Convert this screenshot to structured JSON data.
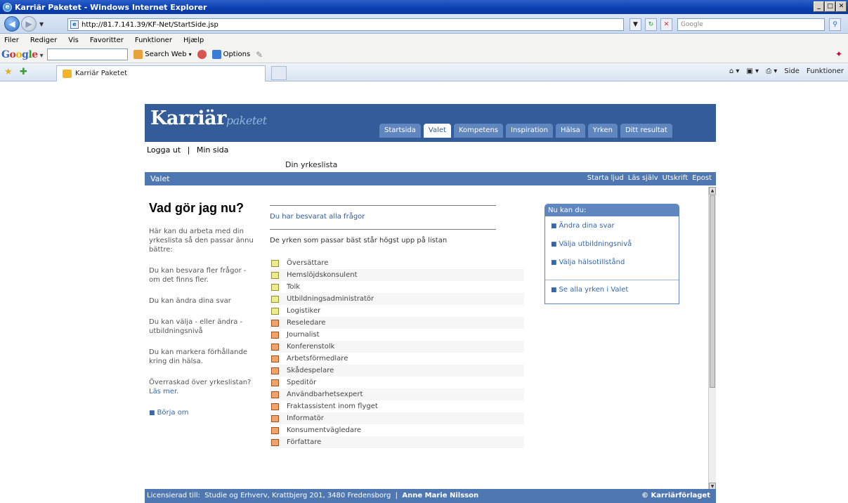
{
  "window": {
    "title": "Karriär Paketet - Windows Internet Explorer",
    "min": "_",
    "max": "□",
    "close": "✕"
  },
  "address": {
    "url": "http://81.7.141.39/KF-Net/StartSide.jsp",
    "search_placeholder": "Google"
  },
  "menu": [
    "Filer",
    "Rediger",
    "Vis",
    "Favoritter",
    "Funktioner",
    "Hjælp"
  ],
  "google_toolbar": {
    "logo": "Google",
    "search_web": "Search Web",
    "options": "Options"
  },
  "tab": {
    "title": "Karriär Paketet"
  },
  "command_bar": [
    "Side",
    "Funktioner"
  ],
  "site": {
    "logo_main": "Karriär",
    "logo_sub": "paketet",
    "nav": [
      "Startsida",
      "Valet",
      "Kompetens",
      "Inspiration",
      "Hälsa",
      "Yrken",
      "Ditt resultat"
    ],
    "active_nav": "Valet",
    "login": "Logga ut",
    "separator": "|",
    "min_sida": "Min sida",
    "subtitle": "Din yrkeslista",
    "section": "Valet",
    "tools": [
      "Starta ljud",
      "Läs själv",
      "Utskrift",
      "Epost"
    ]
  },
  "left": {
    "heading": "Vad gör jag nu?",
    "paras": [
      "Här kan du arbeta med din yrkeslista så den passar ännu bättre:",
      "Du kan besvara fler frågor - om det finns fler.",
      "Du kan ändra dina svar",
      "Du kan välja - eller ändra - utbildningsnivå",
      "Du kan markera förhållande kring din hälsa."
    ],
    "overraskad": "Överraskad över yrkeslistan?",
    "las_mer": "Läs mer.",
    "borja_om": "Börja om"
  },
  "middle": {
    "answered": "Du har besvarat alla frågor",
    "intro": "De yrken som passar bäst står högst upp på listan",
    "jobs": [
      {
        "name": "Översättare",
        "color": "yellow"
      },
      {
        "name": "Hemslöjdskonsulent",
        "color": "yellow"
      },
      {
        "name": "Tolk",
        "color": "yellow"
      },
      {
        "name": "Utbildningsadministratör",
        "color": "yellow"
      },
      {
        "name": "Logistiker",
        "color": "yellow"
      },
      {
        "name": "Reseledare",
        "color": "orange"
      },
      {
        "name": "Journalist",
        "color": "orange"
      },
      {
        "name": "Konferenstolk",
        "color": "orange"
      },
      {
        "name": "Arbetsförmedlare",
        "color": "orange"
      },
      {
        "name": "Skådespelare",
        "color": "orange"
      },
      {
        "name": "Speditör",
        "color": "orange"
      },
      {
        "name": "Användbarhetsexpert",
        "color": "orange"
      },
      {
        "name": "Fraktassistent inom flyget",
        "color": "orange"
      },
      {
        "name": "Informatör",
        "color": "orange"
      },
      {
        "name": "Konsumentvägledare",
        "color": "orange"
      },
      {
        "name": "Författare",
        "color": "orange"
      }
    ]
  },
  "nukan": {
    "header": "Nu kan du:",
    "items": [
      "Ändra dina svar",
      "Välja utbildningsnivå",
      "Välja hälsotillstånd"
    ],
    "se_alla": "Se alla yrken i Valet"
  },
  "footer": {
    "licensed_label": "Licensierad till:",
    "licensee": "Studie og Erhverv, Krattbjerg 201, 3480 Fredensborg",
    "sep": "|",
    "person": "Anne Marie Nilsson",
    "copyright": "© Karriärförlaget"
  },
  "colors": {
    "site_blue": "#335c99",
    "section_blue": "#4f77b1",
    "link_blue": "#3467b0",
    "yellow": "#ecec8c",
    "orange": "#f0a46a"
  }
}
